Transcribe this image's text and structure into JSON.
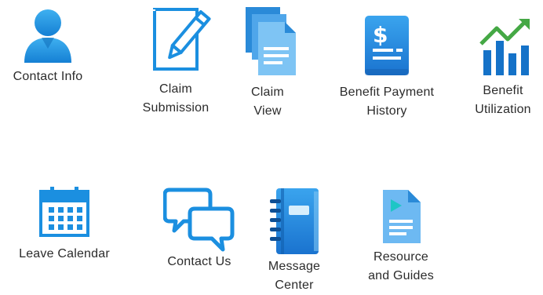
{
  "colors": {
    "primary": "#1b8fe0",
    "dark": "#0f5fae",
    "light": "#5bb8f0",
    "green": "#4caf50",
    "text": "#2b2b2b",
    "background": "#ffffff"
  },
  "tiles": {
    "contact_info": {
      "icon": "person-icon",
      "lines": [
        "Contact Info"
      ]
    },
    "claim_submission": {
      "icon": "pencil-edit-icon",
      "lines": [
        "Claim",
        "Submission"
      ]
    },
    "claim_view": {
      "icon": "documents-stack-icon",
      "lines": [
        "Claim",
        "View"
      ]
    },
    "benefit_payment_history": {
      "icon": "dollar-document-icon",
      "lines": [
        "Benefit Payment",
        "History"
      ]
    },
    "benefit_utilization": {
      "icon": "bar-chart-trend-icon",
      "lines": [
        "Benefit",
        "Utilization"
      ]
    },
    "leave_calendar": {
      "icon": "calendar-icon",
      "lines": [
        "Leave Calendar"
      ]
    },
    "contact_us": {
      "icon": "speech-bubbles-icon",
      "lines": [
        "Contact Us"
      ]
    },
    "message_center": {
      "icon": "notebook-icon",
      "lines": [
        "Message",
        "Center"
      ]
    },
    "resource_and_guides": {
      "icon": "video-document-icon",
      "lines": [
        "Resource",
        "and Guides"
      ]
    }
  }
}
